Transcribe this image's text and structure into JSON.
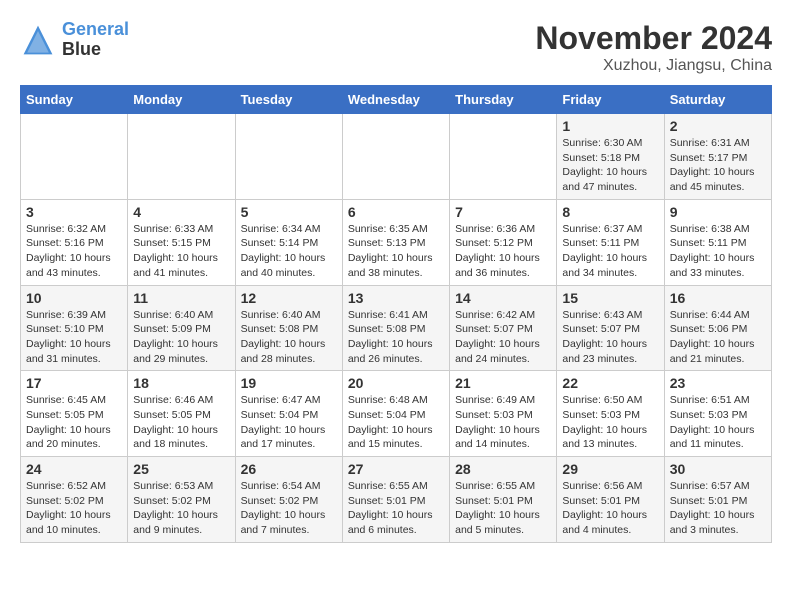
{
  "header": {
    "logo_line1": "General",
    "logo_line2": "Blue",
    "title": "November 2024",
    "subtitle": "Xuzhou, Jiangsu, China"
  },
  "weekdays": [
    "Sunday",
    "Monday",
    "Tuesday",
    "Wednesday",
    "Thursday",
    "Friday",
    "Saturday"
  ],
  "weeks": [
    [
      {
        "day": "",
        "info": ""
      },
      {
        "day": "",
        "info": ""
      },
      {
        "day": "",
        "info": ""
      },
      {
        "day": "",
        "info": ""
      },
      {
        "day": "",
        "info": ""
      },
      {
        "day": "1",
        "info": "Sunrise: 6:30 AM\nSunset: 5:18 PM\nDaylight: 10 hours\nand 47 minutes."
      },
      {
        "day": "2",
        "info": "Sunrise: 6:31 AM\nSunset: 5:17 PM\nDaylight: 10 hours\nand 45 minutes."
      }
    ],
    [
      {
        "day": "3",
        "info": "Sunrise: 6:32 AM\nSunset: 5:16 PM\nDaylight: 10 hours\nand 43 minutes."
      },
      {
        "day": "4",
        "info": "Sunrise: 6:33 AM\nSunset: 5:15 PM\nDaylight: 10 hours\nand 41 minutes."
      },
      {
        "day": "5",
        "info": "Sunrise: 6:34 AM\nSunset: 5:14 PM\nDaylight: 10 hours\nand 40 minutes."
      },
      {
        "day": "6",
        "info": "Sunrise: 6:35 AM\nSunset: 5:13 PM\nDaylight: 10 hours\nand 38 minutes."
      },
      {
        "day": "7",
        "info": "Sunrise: 6:36 AM\nSunset: 5:12 PM\nDaylight: 10 hours\nand 36 minutes."
      },
      {
        "day": "8",
        "info": "Sunrise: 6:37 AM\nSunset: 5:11 PM\nDaylight: 10 hours\nand 34 minutes."
      },
      {
        "day": "9",
        "info": "Sunrise: 6:38 AM\nSunset: 5:11 PM\nDaylight: 10 hours\nand 33 minutes."
      }
    ],
    [
      {
        "day": "10",
        "info": "Sunrise: 6:39 AM\nSunset: 5:10 PM\nDaylight: 10 hours\nand 31 minutes."
      },
      {
        "day": "11",
        "info": "Sunrise: 6:40 AM\nSunset: 5:09 PM\nDaylight: 10 hours\nand 29 minutes."
      },
      {
        "day": "12",
        "info": "Sunrise: 6:40 AM\nSunset: 5:08 PM\nDaylight: 10 hours\nand 28 minutes."
      },
      {
        "day": "13",
        "info": "Sunrise: 6:41 AM\nSunset: 5:08 PM\nDaylight: 10 hours\nand 26 minutes."
      },
      {
        "day": "14",
        "info": "Sunrise: 6:42 AM\nSunset: 5:07 PM\nDaylight: 10 hours\nand 24 minutes."
      },
      {
        "day": "15",
        "info": "Sunrise: 6:43 AM\nSunset: 5:07 PM\nDaylight: 10 hours\nand 23 minutes."
      },
      {
        "day": "16",
        "info": "Sunrise: 6:44 AM\nSunset: 5:06 PM\nDaylight: 10 hours\nand 21 minutes."
      }
    ],
    [
      {
        "day": "17",
        "info": "Sunrise: 6:45 AM\nSunset: 5:05 PM\nDaylight: 10 hours\nand 20 minutes."
      },
      {
        "day": "18",
        "info": "Sunrise: 6:46 AM\nSunset: 5:05 PM\nDaylight: 10 hours\nand 18 minutes."
      },
      {
        "day": "19",
        "info": "Sunrise: 6:47 AM\nSunset: 5:04 PM\nDaylight: 10 hours\nand 17 minutes."
      },
      {
        "day": "20",
        "info": "Sunrise: 6:48 AM\nSunset: 5:04 PM\nDaylight: 10 hours\nand 15 minutes."
      },
      {
        "day": "21",
        "info": "Sunrise: 6:49 AM\nSunset: 5:03 PM\nDaylight: 10 hours\nand 14 minutes."
      },
      {
        "day": "22",
        "info": "Sunrise: 6:50 AM\nSunset: 5:03 PM\nDaylight: 10 hours\nand 13 minutes."
      },
      {
        "day": "23",
        "info": "Sunrise: 6:51 AM\nSunset: 5:03 PM\nDaylight: 10 hours\nand 11 minutes."
      }
    ],
    [
      {
        "day": "24",
        "info": "Sunrise: 6:52 AM\nSunset: 5:02 PM\nDaylight: 10 hours\nand 10 minutes."
      },
      {
        "day": "25",
        "info": "Sunrise: 6:53 AM\nSunset: 5:02 PM\nDaylight: 10 hours\nand 9 minutes."
      },
      {
        "day": "26",
        "info": "Sunrise: 6:54 AM\nSunset: 5:02 PM\nDaylight: 10 hours\nand 7 minutes."
      },
      {
        "day": "27",
        "info": "Sunrise: 6:55 AM\nSunset: 5:01 PM\nDaylight: 10 hours\nand 6 minutes."
      },
      {
        "day": "28",
        "info": "Sunrise: 6:55 AM\nSunset: 5:01 PM\nDaylight: 10 hours\nand 5 minutes."
      },
      {
        "day": "29",
        "info": "Sunrise: 6:56 AM\nSunset: 5:01 PM\nDaylight: 10 hours\nand 4 minutes."
      },
      {
        "day": "30",
        "info": "Sunrise: 6:57 AM\nSunset: 5:01 PM\nDaylight: 10 hours\nand 3 minutes."
      }
    ]
  ]
}
